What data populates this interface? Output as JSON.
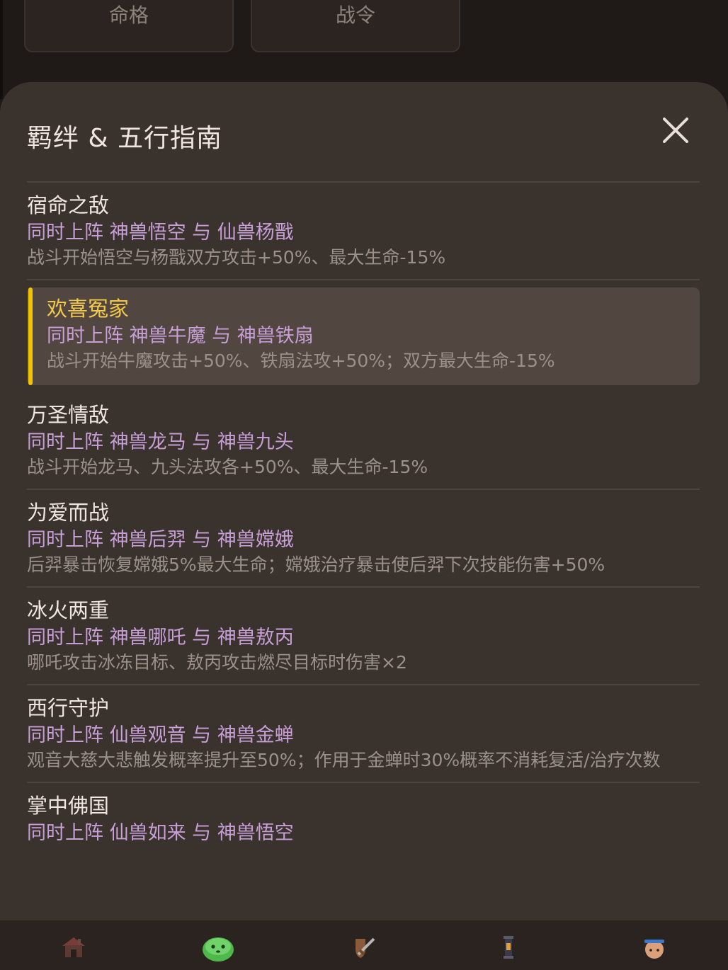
{
  "background_tabs": [
    {
      "label": "命格"
    },
    {
      "label": "战令"
    }
  ],
  "modal": {
    "title": "羁绊 & 五行指南",
    "close_icon": "close-icon"
  },
  "bonds": [
    {
      "name": "宿命之敌",
      "condition": "同时上阵 神兽悟空 与 仙兽杨戬",
      "effect": "战斗开始悟空与杨戬双方攻击+50%、最大生命-15%"
    },
    {
      "name": "欢喜冤家",
      "condition": "同时上阵 神兽牛魔 与 神兽铁扇",
      "effect": "战斗开始牛魔攻击+50%、铁扇法攻+50%；双方最大生命-15%",
      "selected": true
    },
    {
      "name": "万圣情敌",
      "condition": "同时上阵 神兽龙马 与 神兽九头",
      "effect": "战斗开始龙马、九头法攻各+50%、最大生命-15%"
    },
    {
      "name": "为爱而战",
      "condition": "同时上阵 神兽后羿 与 神兽嫦娥",
      "effect": "后羿暴击恢复嫦娥5%最大生命；嫦娥治疗暴击使后羿下次技能伤害+50%"
    },
    {
      "name": "冰火两重",
      "condition": "同时上阵 神兽哪吒 与 神兽敖丙",
      "effect": "哪吒攻击冰冻目标、敖丙攻击燃尽目标时伤害×2"
    },
    {
      "name": "西行守护",
      "condition": "同时上阵 仙兽观音 与 神兽金蝉",
      "effect": "观音大慈大悲触发概率提升至50%；作用于金蝉时30%概率不消耗复活/治疗次数"
    },
    {
      "name": "掌中佛国",
      "condition": "同时上阵 仙兽如来 与 神兽悟空",
      "effect": ""
    }
  ],
  "bottom_nav": [
    {
      "icon": "house-icon"
    },
    {
      "icon": "green-slime-icon"
    },
    {
      "icon": "sword-shield-icon"
    },
    {
      "icon": "lantern-icon"
    },
    {
      "icon": "hero-avatar-icon"
    }
  ],
  "colors": {
    "accent_yellow": "#f2c400",
    "condition_purple": "#c79fd6",
    "sheet_bg": "#3a322d"
  }
}
